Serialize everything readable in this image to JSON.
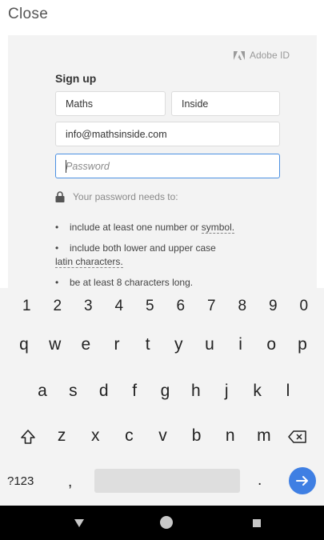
{
  "header": {
    "close_label": "Close"
  },
  "form": {
    "brand": "Adobe ID",
    "title": "Sign up",
    "first_name": "Maths",
    "last_name": "Inside",
    "email": "info@mathsinside.com",
    "password_placeholder": "Password",
    "requirements_heading": "Your password needs to:",
    "req1_text": "include at least one number or ",
    "req1_link": "symbol.",
    "req2_line1": "include both lower and upper case",
    "req2_line2": "latin characters.",
    "req3_text": "be at least 8 characters long.",
    "bullet": "•"
  },
  "keyboard": {
    "numbers": [
      "1",
      "2",
      "3",
      "4",
      "5",
      "6",
      "7",
      "8",
      "9",
      "0"
    ],
    "row1": [
      "q",
      "w",
      "e",
      "r",
      "t",
      "y",
      "u",
      "i",
      "o",
      "p"
    ],
    "row2": [
      "a",
      "s",
      "d",
      "f",
      "g",
      "h",
      "j",
      "k",
      "l"
    ],
    "row3": [
      "z",
      "x",
      "c",
      "v",
      "b",
      "n",
      "m"
    ],
    "symbols_key": "?123",
    "comma": ",",
    "period": "."
  },
  "icons": {
    "adobe": "adobe-logo-icon",
    "lock": "lock-icon",
    "shift": "shift-icon",
    "backspace": "backspace-icon",
    "enter": "arrow-right-icon"
  },
  "colors": {
    "accent": "#3f7fe3",
    "focus_border": "#4a90e2",
    "nav_bar": "#000000"
  }
}
